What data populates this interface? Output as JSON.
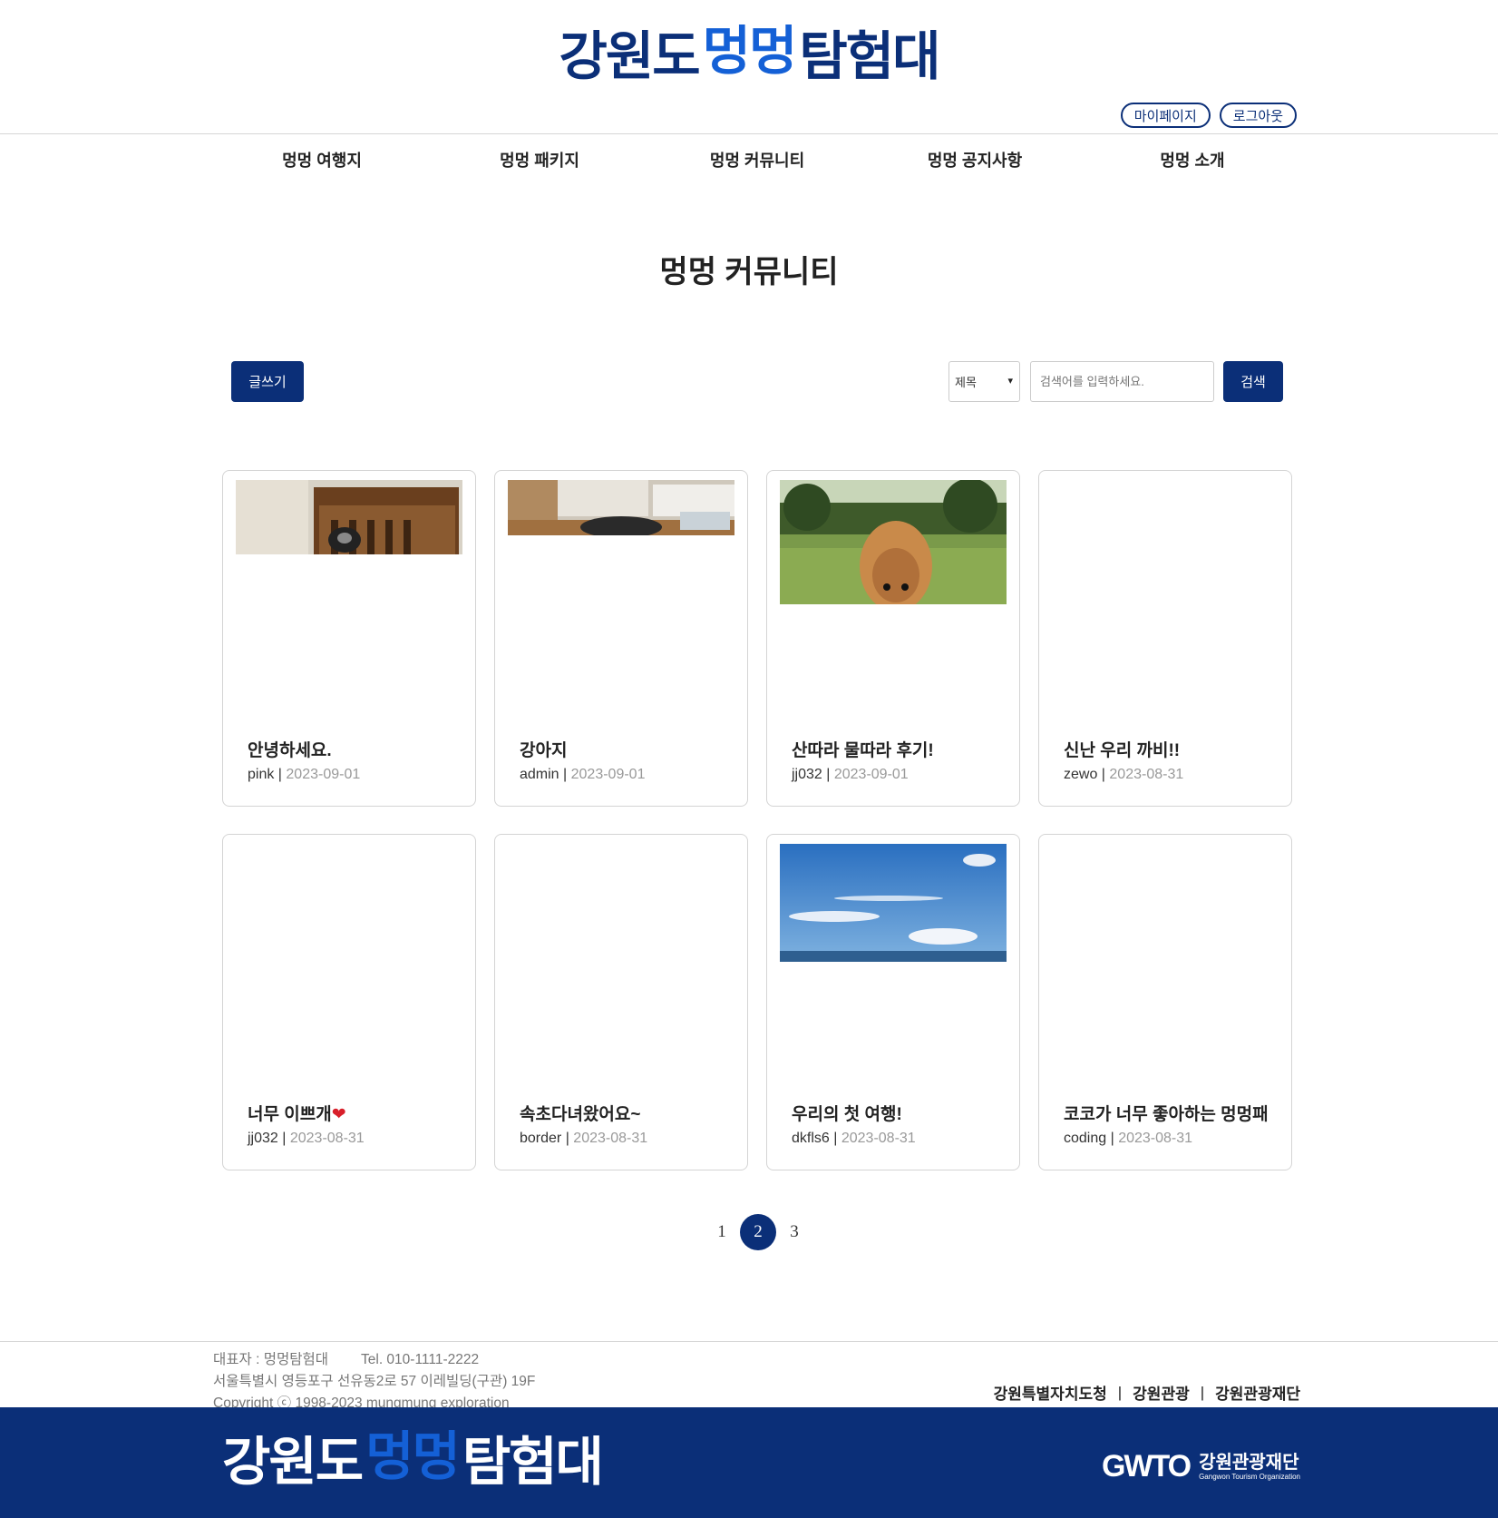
{
  "brand": {
    "part1": "강원도",
    "part2": "멍멍",
    "part3": "탐험대"
  },
  "auth": {
    "mypage": "마이페이지",
    "logout": "로그아웃"
  },
  "nav": [
    {
      "label": "멍멍 여행지"
    },
    {
      "label": "멍멍 패키지"
    },
    {
      "label": "멍멍 커뮤니티"
    },
    {
      "label": "멍멍 공지사항"
    },
    {
      "label": "멍멍 소개"
    }
  ],
  "page_title": "멍멍 커뮤니티",
  "toolbar": {
    "write_label": "글쓰기",
    "search_field_value": "제목",
    "search_placeholder": "검색어를 입력하세요.",
    "search_label": "검색"
  },
  "posts": [
    {
      "title": "안녕하세요.",
      "author": "pink",
      "date": "2023-09-01",
      "image": "chair-cat"
    },
    {
      "title": "강아지",
      "author": "admin",
      "date": "2023-09-01",
      "image": "kitchen-dog"
    },
    {
      "title": "산따라 물따라 후기!",
      "author": "jj032",
      "date": "2023-09-01",
      "image": "park-pomeranian"
    },
    {
      "title": "신난 우리 까비!!",
      "author": "zewo",
      "date": "2023-08-31",
      "image": null
    },
    {
      "title": "너무 이쁘개",
      "author": "jj032",
      "date": "2023-08-31",
      "image": null,
      "emoji": "heart"
    },
    {
      "title": "속초다녀왔어요~",
      "author": "border",
      "date": "2023-08-31",
      "image": null
    },
    {
      "title": "우리의 첫 여행!",
      "author": "dkfls6",
      "date": "2023-08-31",
      "image": "blue-sky-sea"
    },
    {
      "title": "코코가 너무 좋아하는 멍멍패",
      "author": "coding",
      "date": "2023-08-31",
      "image": null
    }
  ],
  "pagination": {
    "pages": [
      "1",
      "2",
      "3"
    ],
    "current": "2"
  },
  "footer": {
    "representative": "대표자 : 멍멍탐험대",
    "tel": "Tel. 010-1111-2222",
    "address": "서울특별시 영등포구 선유동2로 57 이레빌딩(구관) 19F",
    "copyright": "Copyright ⓒ 1998-2023 mungmung exploration",
    "links": [
      "강원특별자치도청",
      "강원관광",
      "강원관광재단"
    ],
    "gwto_mark": "GWTO",
    "gwto_ko": "강원관광재단",
    "gwto_en": "Gangwon Tourism Organization"
  },
  "colors": {
    "primary": "#0b2f78",
    "accent": "#1460d6",
    "heart": "#d81f2a"
  }
}
